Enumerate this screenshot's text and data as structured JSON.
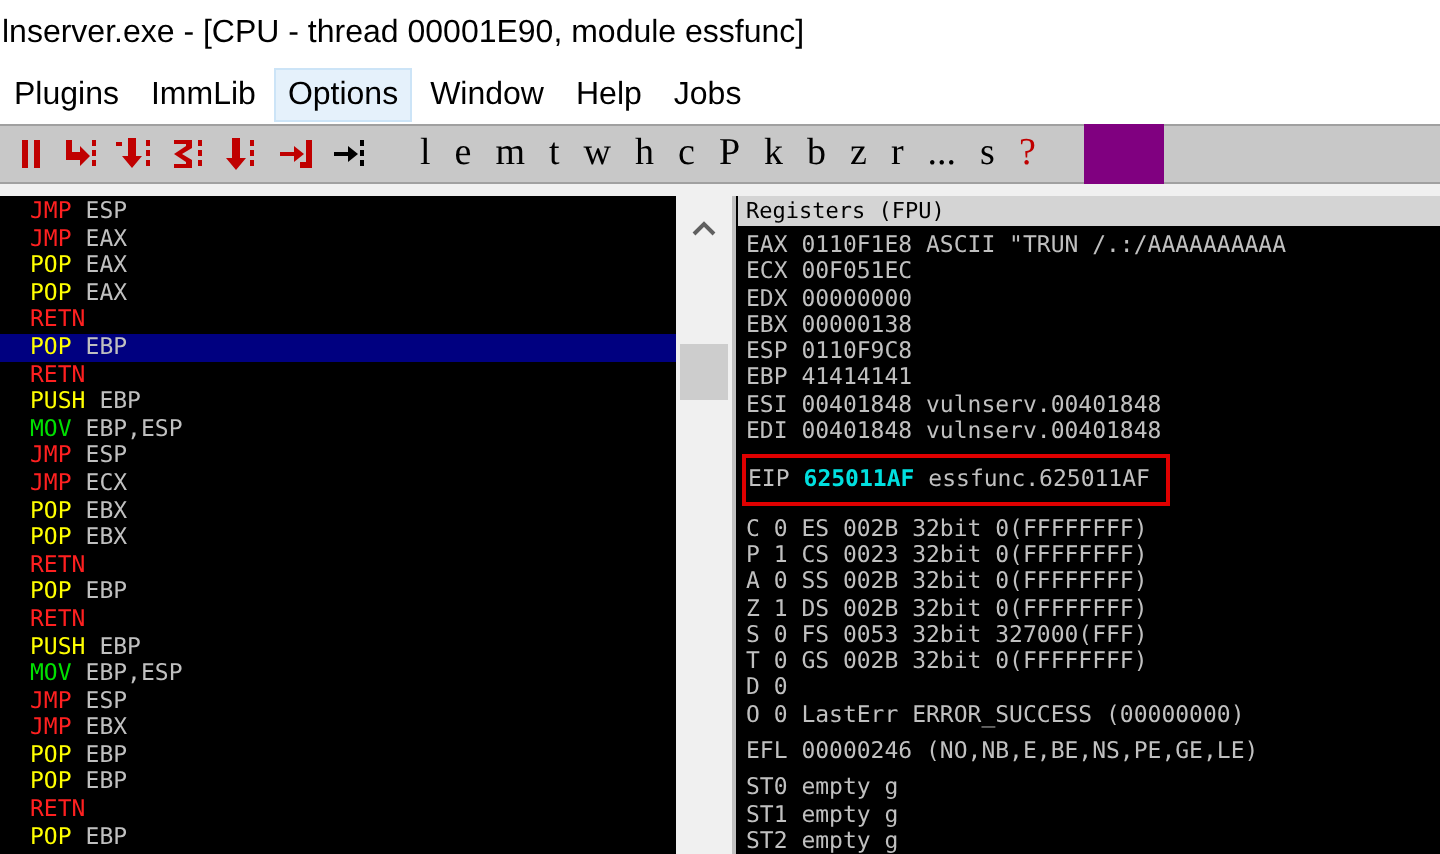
{
  "window": {
    "title": "lnserver.exe - [CPU - thread 00001E90, module essfunc]"
  },
  "menu": [
    {
      "label": "Plugins",
      "selected": false
    },
    {
      "label": "ImmLib",
      "selected": false
    },
    {
      "label": "Options",
      "selected": true
    },
    {
      "label": "Window",
      "selected": false
    },
    {
      "label": "Help",
      "selected": false
    },
    {
      "label": "Jobs",
      "selected": false
    }
  ],
  "toolbar": {
    "letters": [
      "l",
      "e",
      "m",
      "t",
      "w",
      "h",
      "c",
      "P",
      "k",
      "b",
      "z",
      "r",
      "...",
      "s",
      "?"
    ]
  },
  "disassembly": [
    {
      "kind": "jump",
      "mnemonic": "JMP",
      "operand": "ESP",
      "selected": false
    },
    {
      "kind": "jump",
      "mnemonic": "JMP",
      "operand": "EAX",
      "selected": false
    },
    {
      "kind": "stack",
      "mnemonic": "POP",
      "operand": "EAX",
      "selected": false
    },
    {
      "kind": "stack",
      "mnemonic": "POP",
      "operand": "EAX",
      "selected": false
    },
    {
      "kind": "return",
      "mnemonic": "RETN",
      "selected": false
    },
    {
      "kind": "stack",
      "mnemonic": "POP",
      "operand": "EBP",
      "selected": true
    },
    {
      "kind": "return",
      "mnemonic": "RETN",
      "selected": false
    },
    {
      "kind": "stack",
      "mnemonic": "PUSH",
      "operand": "EBP",
      "selected": false
    },
    {
      "kind": "move",
      "mnemonic": "MOV",
      "operand": "EBP,ESP",
      "selected": false
    },
    {
      "kind": "jump",
      "mnemonic": "JMP",
      "operand": "ESP",
      "selected": false
    },
    {
      "kind": "jump",
      "mnemonic": "JMP",
      "operand": "ECX",
      "selected": false
    },
    {
      "kind": "stack",
      "mnemonic": "POP",
      "operand": "EBX",
      "selected": false
    },
    {
      "kind": "stack",
      "mnemonic": "POP",
      "operand": "EBX",
      "selected": false
    },
    {
      "kind": "return",
      "mnemonic": "RETN",
      "selected": false
    },
    {
      "kind": "stack",
      "mnemonic": "POP",
      "operand": "EBP",
      "selected": false
    },
    {
      "kind": "return",
      "mnemonic": "RETN",
      "selected": false
    },
    {
      "kind": "stack",
      "mnemonic": "PUSH",
      "operand": "EBP",
      "selected": false
    },
    {
      "kind": "move",
      "mnemonic": "MOV",
      "operand": "EBP,ESP",
      "selected": false
    },
    {
      "kind": "jump",
      "mnemonic": "JMP",
      "operand": "ESP",
      "selected": false
    },
    {
      "kind": "jump",
      "mnemonic": "JMP",
      "operand": "EBX",
      "selected": false
    },
    {
      "kind": "stack",
      "mnemonic": "POP",
      "operand": "EBP",
      "selected": false
    },
    {
      "kind": "stack",
      "mnemonic": "POP",
      "operand": "EBP",
      "selected": false
    },
    {
      "kind": "return",
      "mnemonic": "RETN",
      "selected": false
    },
    {
      "kind": "stack",
      "mnemonic": "POP",
      "operand": "EBP",
      "selected": false
    }
  ],
  "registers": {
    "title": "Registers (FPU)",
    "groups": [
      [
        {
          "kind": "plain",
          "text": "EAX 0110F1E8 ASCII \"TRUN /.:/AAAAAAAAAA"
        },
        {
          "kind": "plain",
          "text": "ECX 00F051EC"
        },
        {
          "kind": "plain",
          "text": "EDX 00000000"
        },
        {
          "kind": "plain",
          "text": "EBX 00000138"
        },
        {
          "kind": "plain",
          "text": "ESP 0110F9C8"
        },
        {
          "kind": "plain",
          "text": "EBP 41414141"
        },
        {
          "kind": "plain",
          "text": "ESI 00401848 vulnserv.00401848"
        },
        {
          "kind": "plain",
          "text": "EDI 00401848 vulnserv.00401848"
        }
      ],
      [
        {
          "kind": "eip",
          "name": "EIP",
          "value": "625011AF",
          "comment": "essfunc.625011AF",
          "highlighted": true
        }
      ],
      [
        {
          "kind": "plain",
          "text": "C 0  ES 002B 32bit 0(FFFFFFFF)"
        },
        {
          "kind": "plain",
          "text": "P 1  CS 0023 32bit 0(FFFFFFFF)"
        },
        {
          "kind": "plain",
          "text": "A 0  SS 002B 32bit 0(FFFFFFFF)"
        },
        {
          "kind": "plain",
          "text": "Z 1  DS 002B 32bit 0(FFFFFFFF)"
        },
        {
          "kind": "plain",
          "text": "S 0  FS 0053 32bit 327000(FFF)"
        },
        {
          "kind": "plain",
          "text": "T 0  GS 002B 32bit 0(FFFFFFFF)"
        },
        {
          "kind": "plain",
          "text": "D 0"
        },
        {
          "kind": "plain",
          "text": "O 0  LastErr ERROR_SUCCESS (00000000)"
        }
      ],
      [
        {
          "kind": "plain",
          "text": "EFL 00000246 (NO,NB,E,BE,NS,PE,GE,LE)"
        }
      ],
      [
        {
          "kind": "plain",
          "text": "ST0 empty g"
        },
        {
          "kind": "plain",
          "text": "ST1 empty g"
        },
        {
          "kind": "plain",
          "text": "ST2 empty g"
        }
      ]
    ]
  }
}
